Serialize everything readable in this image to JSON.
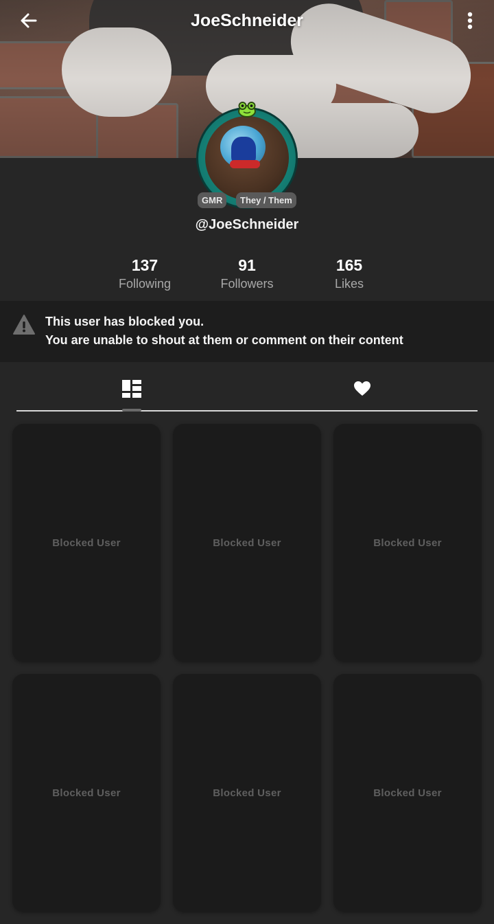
{
  "header": {
    "title": "JoeSchneider",
    "back_icon": "arrow-left-icon",
    "menu_icon": "more-vertical-icon"
  },
  "profile": {
    "handle": "@JoeSchneider",
    "badges": [
      "GMR",
      "They / Them"
    ],
    "ring_color": "#1b9c8e",
    "frog_badge_color": "#8ee03a"
  },
  "stats": [
    {
      "value": "137",
      "label": "Following"
    },
    {
      "value": "91",
      "label": "Followers"
    },
    {
      "value": "165",
      "label": "Likes"
    }
  ],
  "notice": {
    "icon": "warning-icon",
    "line1": "This user has blocked you.",
    "line2": "You are unable to shout at them or comment on their content"
  },
  "tabs": [
    {
      "icon": "posts-grid-icon",
      "active": true
    },
    {
      "icon": "heart-icon",
      "active": false
    }
  ],
  "grid": {
    "cards": [
      {
        "label": "Blocked User"
      },
      {
        "label": "Blocked User"
      },
      {
        "label": "Blocked User"
      },
      {
        "label": "Blocked User"
      },
      {
        "label": "Blocked User"
      },
      {
        "label": "Blocked User"
      }
    ]
  }
}
